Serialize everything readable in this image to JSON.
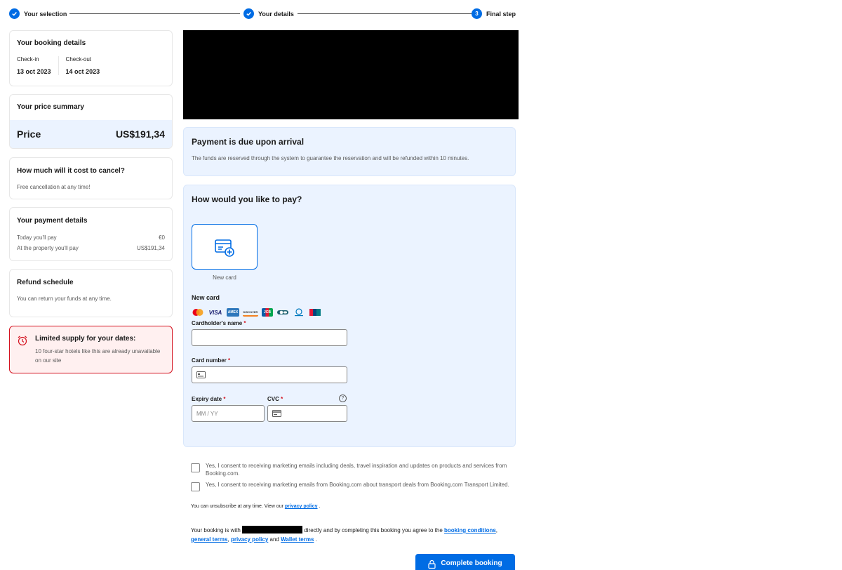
{
  "stepper": {
    "steps": [
      {
        "label": "Your selection",
        "state": "done"
      },
      {
        "label": "Your details",
        "state": "done"
      },
      {
        "label": "Final step",
        "state": "current",
        "number": "3"
      }
    ]
  },
  "sidebar": {
    "booking": {
      "title": "Your booking details",
      "checkin_label": "Check-in",
      "checkin_value": "13 oct 2023",
      "checkout_label": "Check-out",
      "checkout_value": "14 oct 2023"
    },
    "price": {
      "title": "Your price summary",
      "label": "Price",
      "value": "US$191,34"
    },
    "cancel": {
      "title": "How much will it cost to cancel?",
      "text": "Free cancellation at any time!"
    },
    "payment": {
      "title": "Your payment details",
      "rows": [
        {
          "label": "Today you'll pay",
          "value": "€0"
        },
        {
          "label": "At the property you'll pay",
          "value": "US$191,34"
        }
      ]
    },
    "refund": {
      "title": "Refund schedule",
      "text": "You can return your funds at any time."
    },
    "supply": {
      "title": "Limited supply for your dates:",
      "text": "10 four-star hotels like this are already unavailable on our site"
    }
  },
  "main": {
    "due": {
      "title": "Payment is due upon arrival",
      "text": "The funds are reserved through the system to guarantee the reservation and will be refunded within 10 minutes."
    },
    "pay": {
      "title": "How would you like to pay?",
      "tile_caption": "New card",
      "new_card_title": "New card",
      "card_logos": [
        "mastercard",
        "visa",
        "amex",
        "discover",
        "jcb",
        "cartes-bancaires",
        "diners-club",
        "unionpay"
      ],
      "visa_text": "VISA",
      "amex_text": "AMEX",
      "discover_text": "DISCOVER",
      "jcb_text": "JCB",
      "cardholder_label": "Cardholder's name",
      "card_number_label": "Card number",
      "expiry_label": "Expiry date",
      "expiry_placeholder": "MM / YY",
      "cvc_label": "CVC",
      "required_mark": "*",
      "help_mark": "?"
    },
    "consents": [
      "Yes, I consent to receiving marketing emails including deals, travel inspiration and updates on products and services from Booking.com.",
      "Yes, I consent to receiving marketing emails from Booking.com about transport deals from Booking.com Transport Limited."
    ],
    "unsubscribe": {
      "text": "You can unsubscribe at any time. View our",
      "link": "privacy policy",
      "end": "."
    },
    "terms": {
      "prefix": "Your booking is with",
      "middle": "directly and by completing this booking you agree to the",
      "booking_conditions": "booking conditions",
      "comma1": ",",
      "general_terms": "general terms",
      "comma2": ",",
      "privacy_policy": "privacy policy",
      "and": "and",
      "wallet_terms": "Wallet terms",
      "end": "."
    },
    "complete_button": "Complete booking"
  },
  "colors": {
    "accent": "#006ce4",
    "panel_bg": "#ebf3ff",
    "alert_border": "#d4111e",
    "alert_bg": "#fff0f0"
  }
}
